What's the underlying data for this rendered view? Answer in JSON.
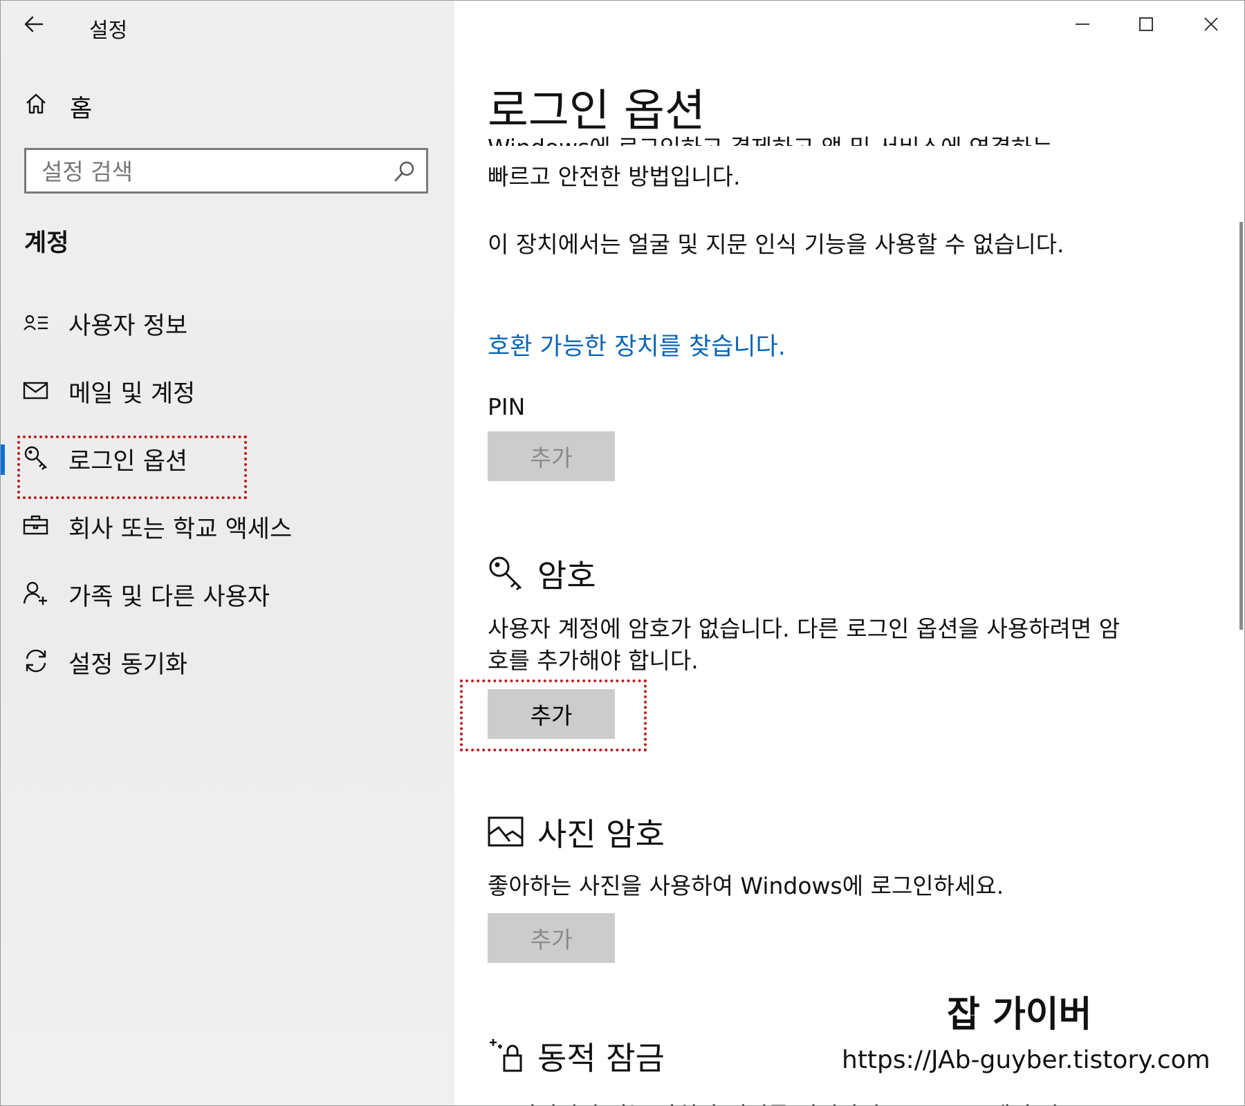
{
  "window": {
    "title": "설정",
    "controls": {
      "minimize_icon": "minimize-icon",
      "maximize_icon": "maximize-icon",
      "close_icon": "close-icon"
    }
  },
  "sidebar": {
    "home_label": "홈",
    "search": {
      "placeholder": "설정 검색",
      "value": ""
    },
    "section_title": "계정",
    "items": [
      {
        "label": "사용자 정보",
        "icon": "user-info-icon"
      },
      {
        "label": "메일 및 계정",
        "icon": "mail-icon"
      },
      {
        "label": "로그인 옵션",
        "icon": "key-icon",
        "selected": true
      },
      {
        "label": "회사 또는 학교 액세스",
        "icon": "briefcase-icon"
      },
      {
        "label": "가족 및 다른 사용자",
        "icon": "add-person-icon"
      },
      {
        "label": "설정 동기화",
        "icon": "sync-icon"
      }
    ]
  },
  "main": {
    "title": "로그인 옵션",
    "hello_cutoff_text": "Windows에 로그인하고 결제하고 앱 및 서비스에 연결하는",
    "hello_text_line2": "빠르고 안전한 방법입니다.",
    "unavailable_text": "이 장치에서는 얼굴 및 지문 인식 기능을 사용할 수 없습니다.",
    "find_devices_link": "호환 가능한 장치를 찾습니다.",
    "pin": {
      "label": "PIN",
      "button": "추가"
    },
    "password": {
      "heading": "암호",
      "description": "사용자 계정에 암호가 없습니다. 다른 로그인 옵션을 사용하려면 암호를 추가해야 합니다.",
      "button": "추가"
    },
    "picture_password": {
      "heading": "사진 암호",
      "description": "좋아하는 사진을 사용하여 Windows에 로그인하세요.",
      "button": "추가"
    },
    "dynamic_lock": {
      "heading": "동적 잠금",
      "cutoff_text": "연결되어 있는 장치가 범위를 벗어나면 Windows에서 잠"
    }
  },
  "watermark": {
    "name": "잡 가이버",
    "url": "https://JAb-guyber.tistory.com"
  },
  "colors": {
    "accent": "#0a6fd6",
    "link": "#0a64b4",
    "highlight_border": "#b51d1d",
    "button_bg": "#cccccc",
    "sidebar_bg": "#eeeeee"
  }
}
